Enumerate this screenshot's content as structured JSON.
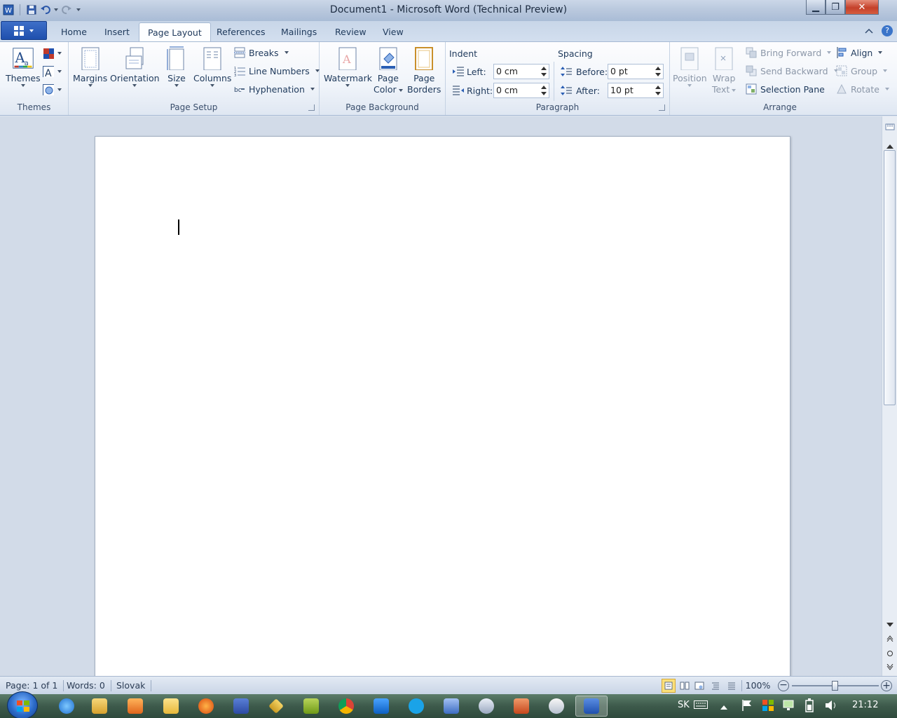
{
  "window": {
    "title": "Document1  -  Microsoft Word (Technical Preview)",
    "min_glyph": "▁",
    "max_glyph": "❐",
    "close_glyph": "✕"
  },
  "tabs": [
    {
      "label": "Home"
    },
    {
      "label": "Insert"
    },
    {
      "label": "Page Layout",
      "active": true
    },
    {
      "label": "References"
    },
    {
      "label": "Mailings"
    },
    {
      "label": "Review"
    },
    {
      "label": "View"
    }
  ],
  "ribbon": {
    "themes": {
      "label": "Themes",
      "button": "Themes"
    },
    "page_setup": {
      "label": "Page Setup",
      "margins": "Margins",
      "orientation": "Orientation",
      "size": "Size",
      "columns": "Columns",
      "breaks": "Breaks",
      "line_numbers": "Line Numbers",
      "hyphenation": "Hyphenation"
    },
    "page_background": {
      "label": "Page Background",
      "watermark": "Watermark",
      "page_color_1": "Page",
      "page_color_2": "Color",
      "page_borders_1": "Page",
      "page_borders_2": "Borders"
    },
    "paragraph": {
      "label": "Paragraph",
      "indent_title": "Indent",
      "spacing_title": "Spacing",
      "left_label": "Left:",
      "left_value": "0 cm",
      "right_label": "Right:",
      "right_value": "0 cm",
      "before_label": "Before:",
      "before_value": "0 pt",
      "after_label": "After:",
      "after_value": "10 pt"
    },
    "arrange": {
      "label": "Arrange",
      "position": "Position",
      "wrap_1": "Wrap",
      "wrap_2": "Text",
      "bring_forward": "Bring Forward",
      "send_backward": "Send Backward",
      "selection_pane": "Selection Pane",
      "align": "Align",
      "group": "Group",
      "rotate": "Rotate"
    }
  },
  "status": {
    "page": "Page: 1 of 1",
    "words": "Words: 0",
    "language": "Slovak",
    "zoom": "100%",
    "zoom_fraction": 0.5
  },
  "taskbar": {
    "language": "SK",
    "time": "21:12"
  },
  "colors": {
    "accent": "#1f4fad",
    "ribbon_bg": "#f0f4fa",
    "doc_bg": "#d2dbe8",
    "close_red": "#c4402a"
  }
}
